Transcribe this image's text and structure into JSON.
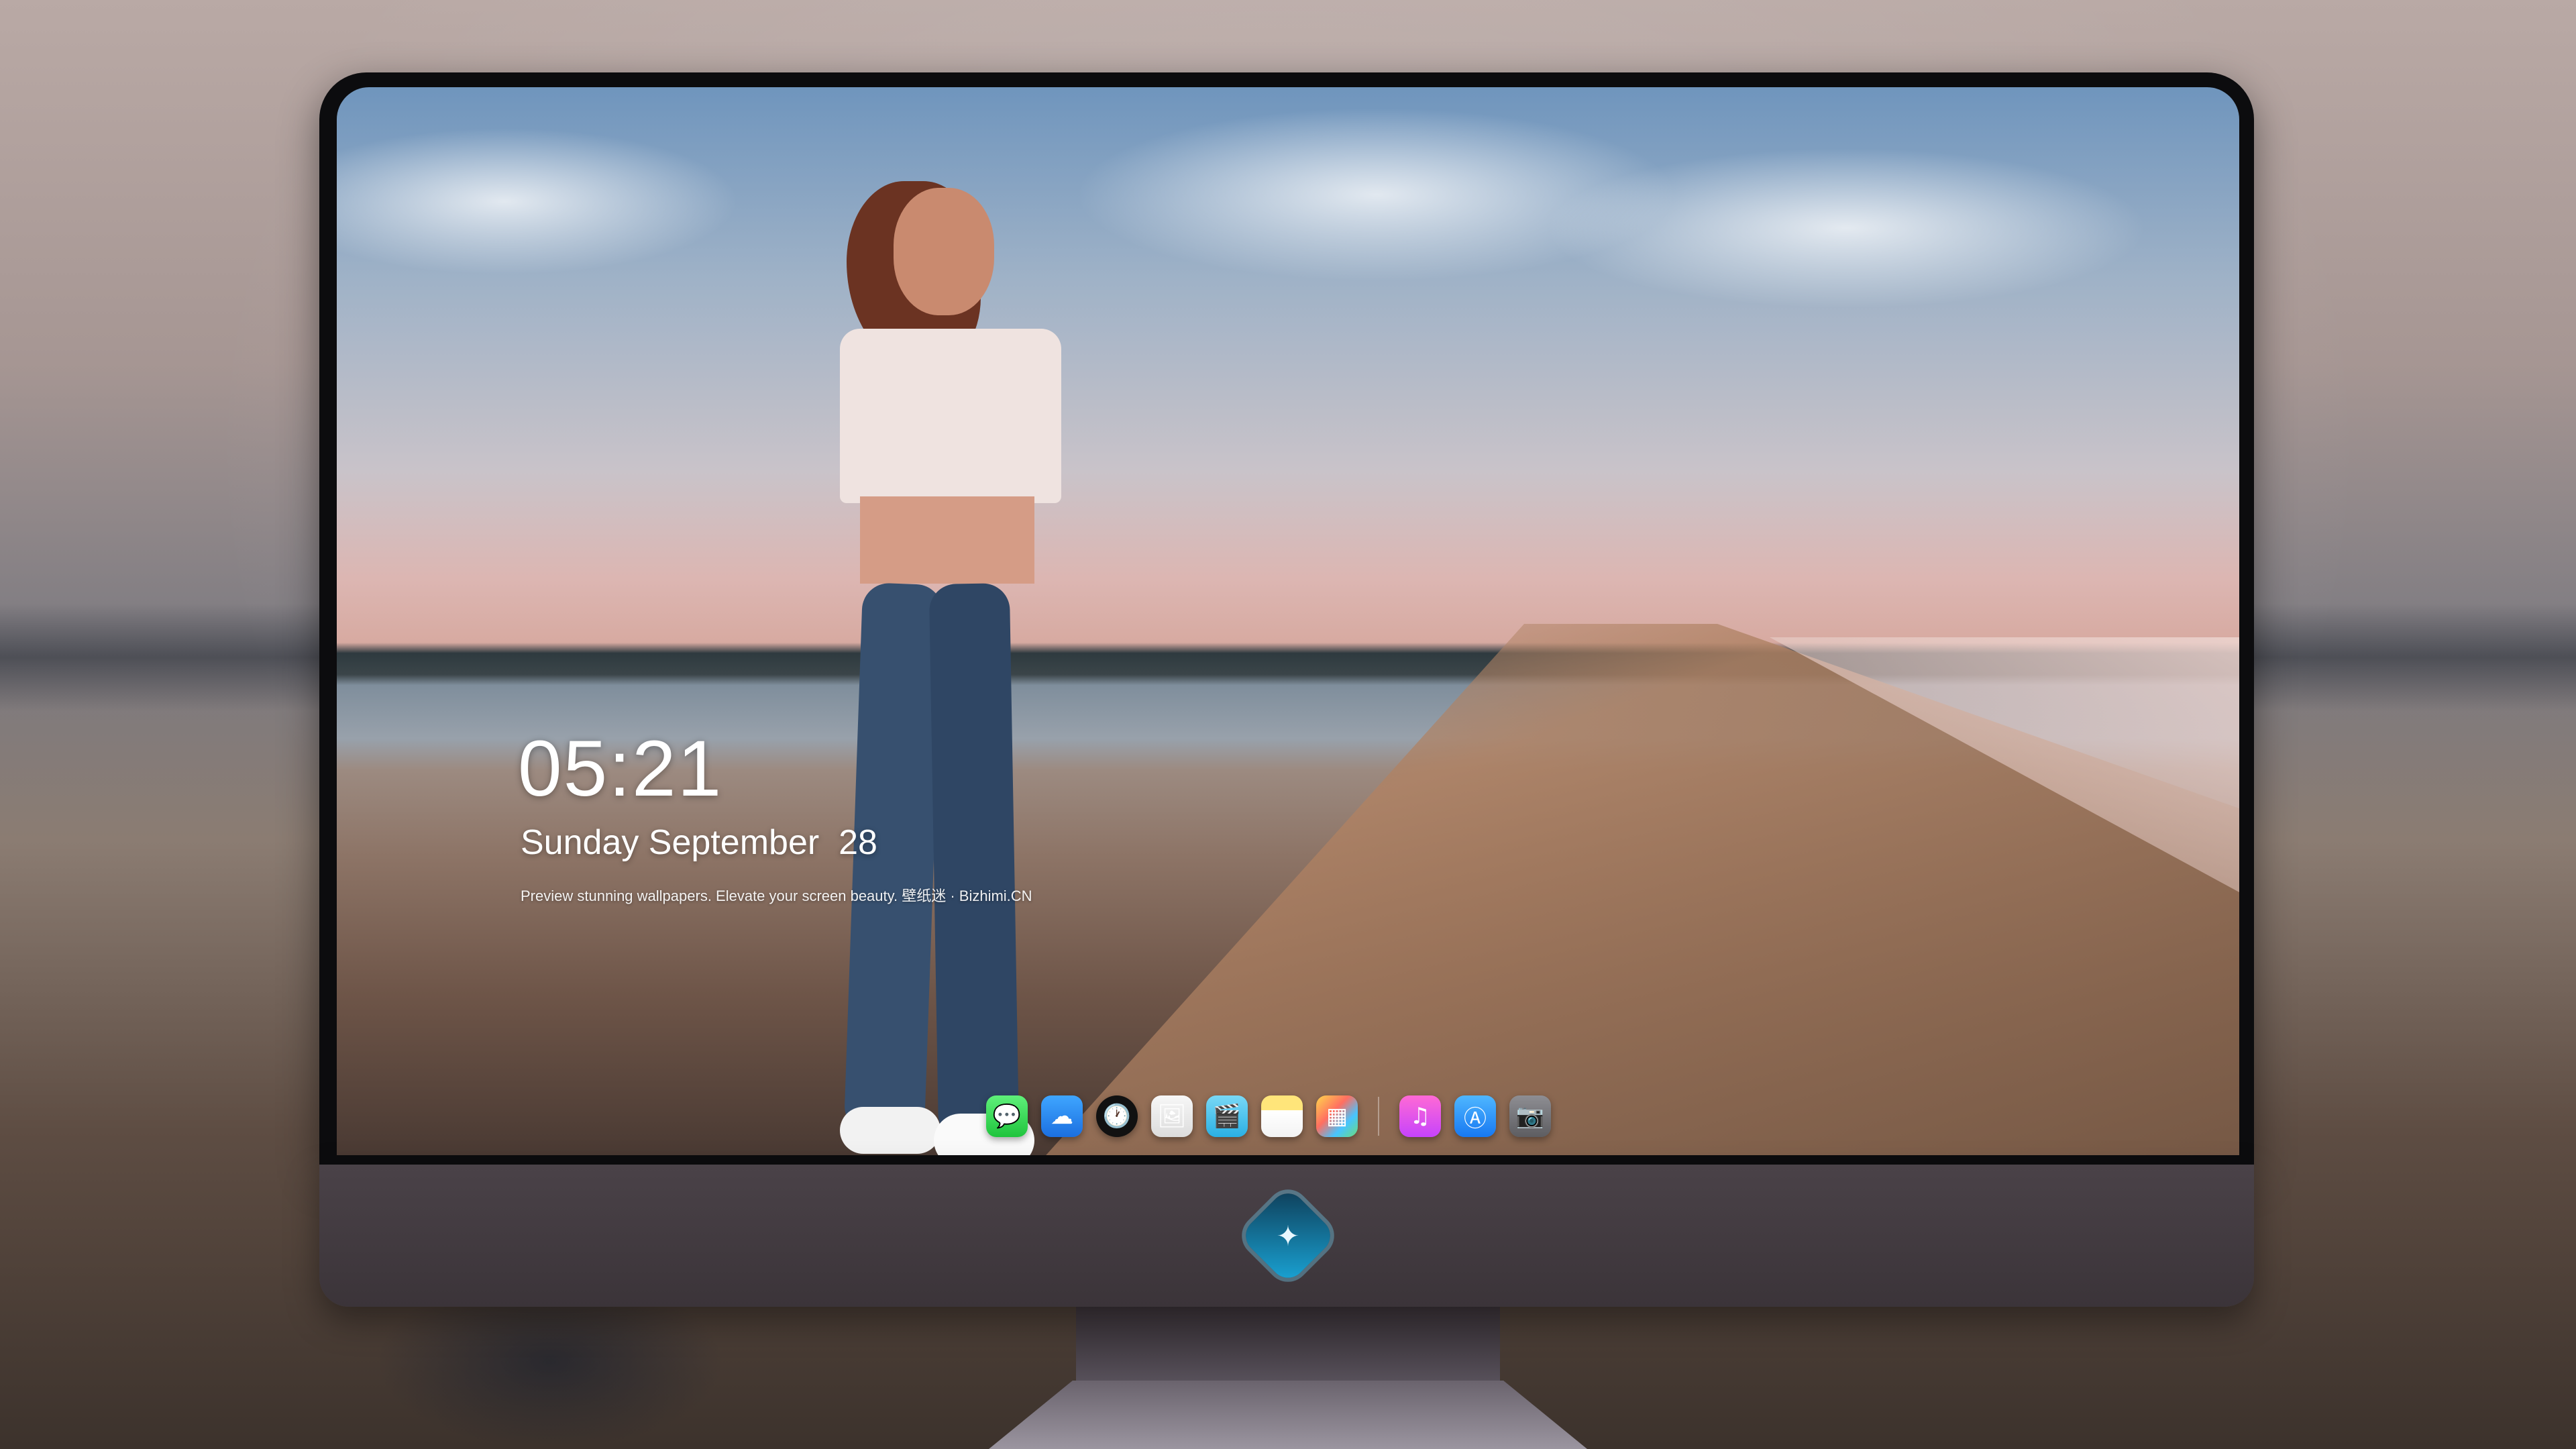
{
  "lock_screen": {
    "time": "05:21",
    "date": "Sunday September  28",
    "caption": "Preview stunning wallpapers. Elevate your screen beauty. 壁纸迷 · Bizhimi.CN"
  },
  "dock": {
    "apps": [
      {
        "name": "messages-icon",
        "glyph": "💬"
      },
      {
        "name": "weather-icon",
        "glyph": "☁"
      },
      {
        "name": "clock-icon",
        "glyph": "🕐"
      },
      {
        "name": "preview-icon",
        "glyph": "🖼"
      },
      {
        "name": "clips-icon",
        "glyph": "🎬"
      },
      {
        "name": "notes-icon",
        "glyph": ""
      },
      {
        "name": "photos-icon",
        "glyph": "▦"
      },
      {
        "name": "music-icon",
        "glyph": "♫"
      },
      {
        "name": "app-store-icon",
        "glyph": "Ⓐ"
      },
      {
        "name": "camera-icon",
        "glyph": "📷"
      }
    ]
  },
  "brand": {
    "logo_glyph": "✦"
  }
}
